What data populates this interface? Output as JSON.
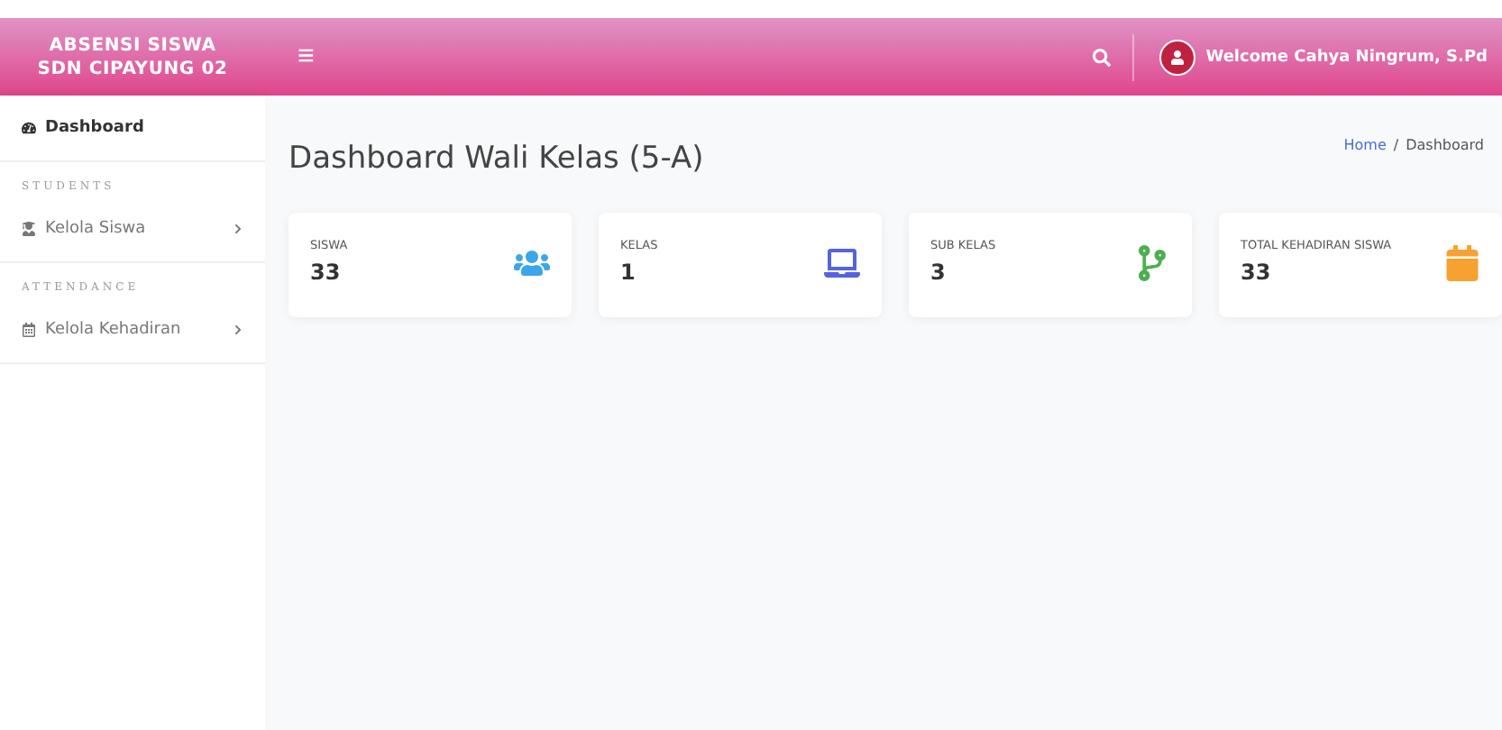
{
  "brand": {
    "line1": "ABSENSI SISWA",
    "line2": "SDN CIPAYUNG 02"
  },
  "menu_icon": "≡",
  "user": {
    "welcome": "Welcome Cahya Ningrum, S.Pd"
  },
  "sidebar": {
    "items": [
      {
        "kind": "link",
        "label": "Dashboard",
        "selected": true
      },
      {
        "kind": "heading",
        "label": "STUDENTS"
      },
      {
        "kind": "link",
        "label": "Kelola Siswa",
        "selected": false
      },
      {
        "kind": "heading",
        "label": "ATTENDANCE"
      },
      {
        "kind": "link",
        "label": "Kelola Kehadiran",
        "selected": false
      }
    ]
  },
  "page": {
    "title": "Dashboard Wali Kelas (5-A)",
    "breadcrumb_separator": "/",
    "breadcrumb": [
      {
        "label": "Home",
        "kind": "link"
      },
      {
        "label": "Dashboard",
        "kind": "current"
      }
    ]
  },
  "cards": [
    {
      "label": "SISWA",
      "value": "33",
      "kind": "users"
    },
    {
      "label": "KELAS",
      "value": "1",
      "kind": "laptop"
    },
    {
      "label": "SUB KELAS",
      "value": "3",
      "kind": "branch"
    },
    {
      "label": "TOTAL KEHADIRAN SISWA",
      "value": "33",
      "kind": "calendar"
    }
  ]
}
